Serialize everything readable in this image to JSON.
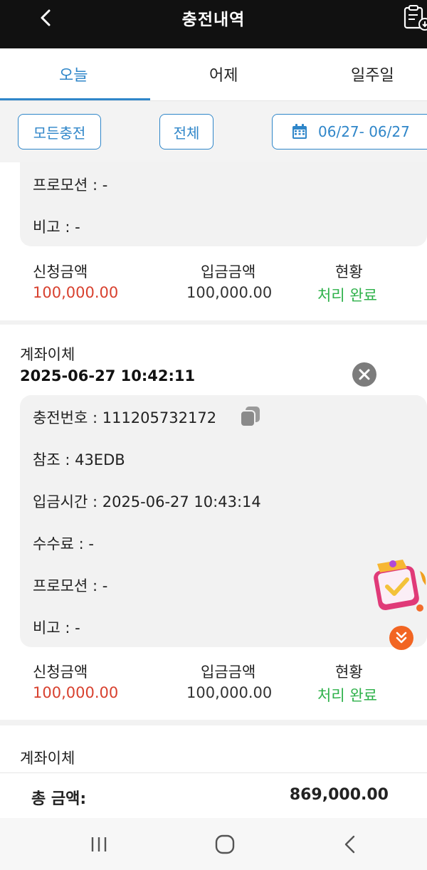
{
  "header": {
    "title": "충전내역",
    "back_icon": "chevron-left-icon",
    "action_icon": "clipboard-download-icon"
  },
  "tabs": [
    {
      "label": "오늘",
      "active": true
    },
    {
      "label": "어제",
      "active": false
    },
    {
      "label": "일주일",
      "active": false
    }
  ],
  "filters": {
    "all_charge_label": "모든충전",
    "all_label": "전체",
    "date_range": "06/27- 06/27"
  },
  "cards": [
    {
      "details": [
        {
          "label": "프로모션",
          "value": "-"
        },
        {
          "label": "비고",
          "value": "-"
        }
      ],
      "summary": {
        "requested_label": "신청금액",
        "requested_value": "100,000.00",
        "deposit_label": "입금금액",
        "deposit_value": "100,000.00",
        "status_label": "현황",
        "status_value": "처리 완료"
      }
    },
    {
      "title": "계좌이체",
      "time": "2025-06-27 10:42:11",
      "details": [
        {
          "label": "충전번호",
          "value": "111205732172"
        },
        {
          "label": "참조",
          "value": "43EDB"
        },
        {
          "label": "입금시간",
          "value": "2025-06-27 10:43:14"
        },
        {
          "label": "수수료",
          "value": "-"
        },
        {
          "label": "프로모션",
          "value": "-"
        },
        {
          "label": "비고",
          "value": "-"
        }
      ],
      "summary": {
        "requested_label": "신청금액",
        "requested_value": "100,000.00",
        "deposit_label": "입금금액",
        "deposit_value": "100,000.00",
        "status_label": "현황",
        "status_value": "처리 완료"
      }
    },
    {
      "title": "계좌이체"
    }
  ],
  "total": {
    "label": "총 금액:",
    "value": "869,000.00"
  },
  "colors": {
    "accent": "#2f86c9",
    "requested": "#d8412f",
    "status": "#2eb14a",
    "topbar": "#111111"
  }
}
